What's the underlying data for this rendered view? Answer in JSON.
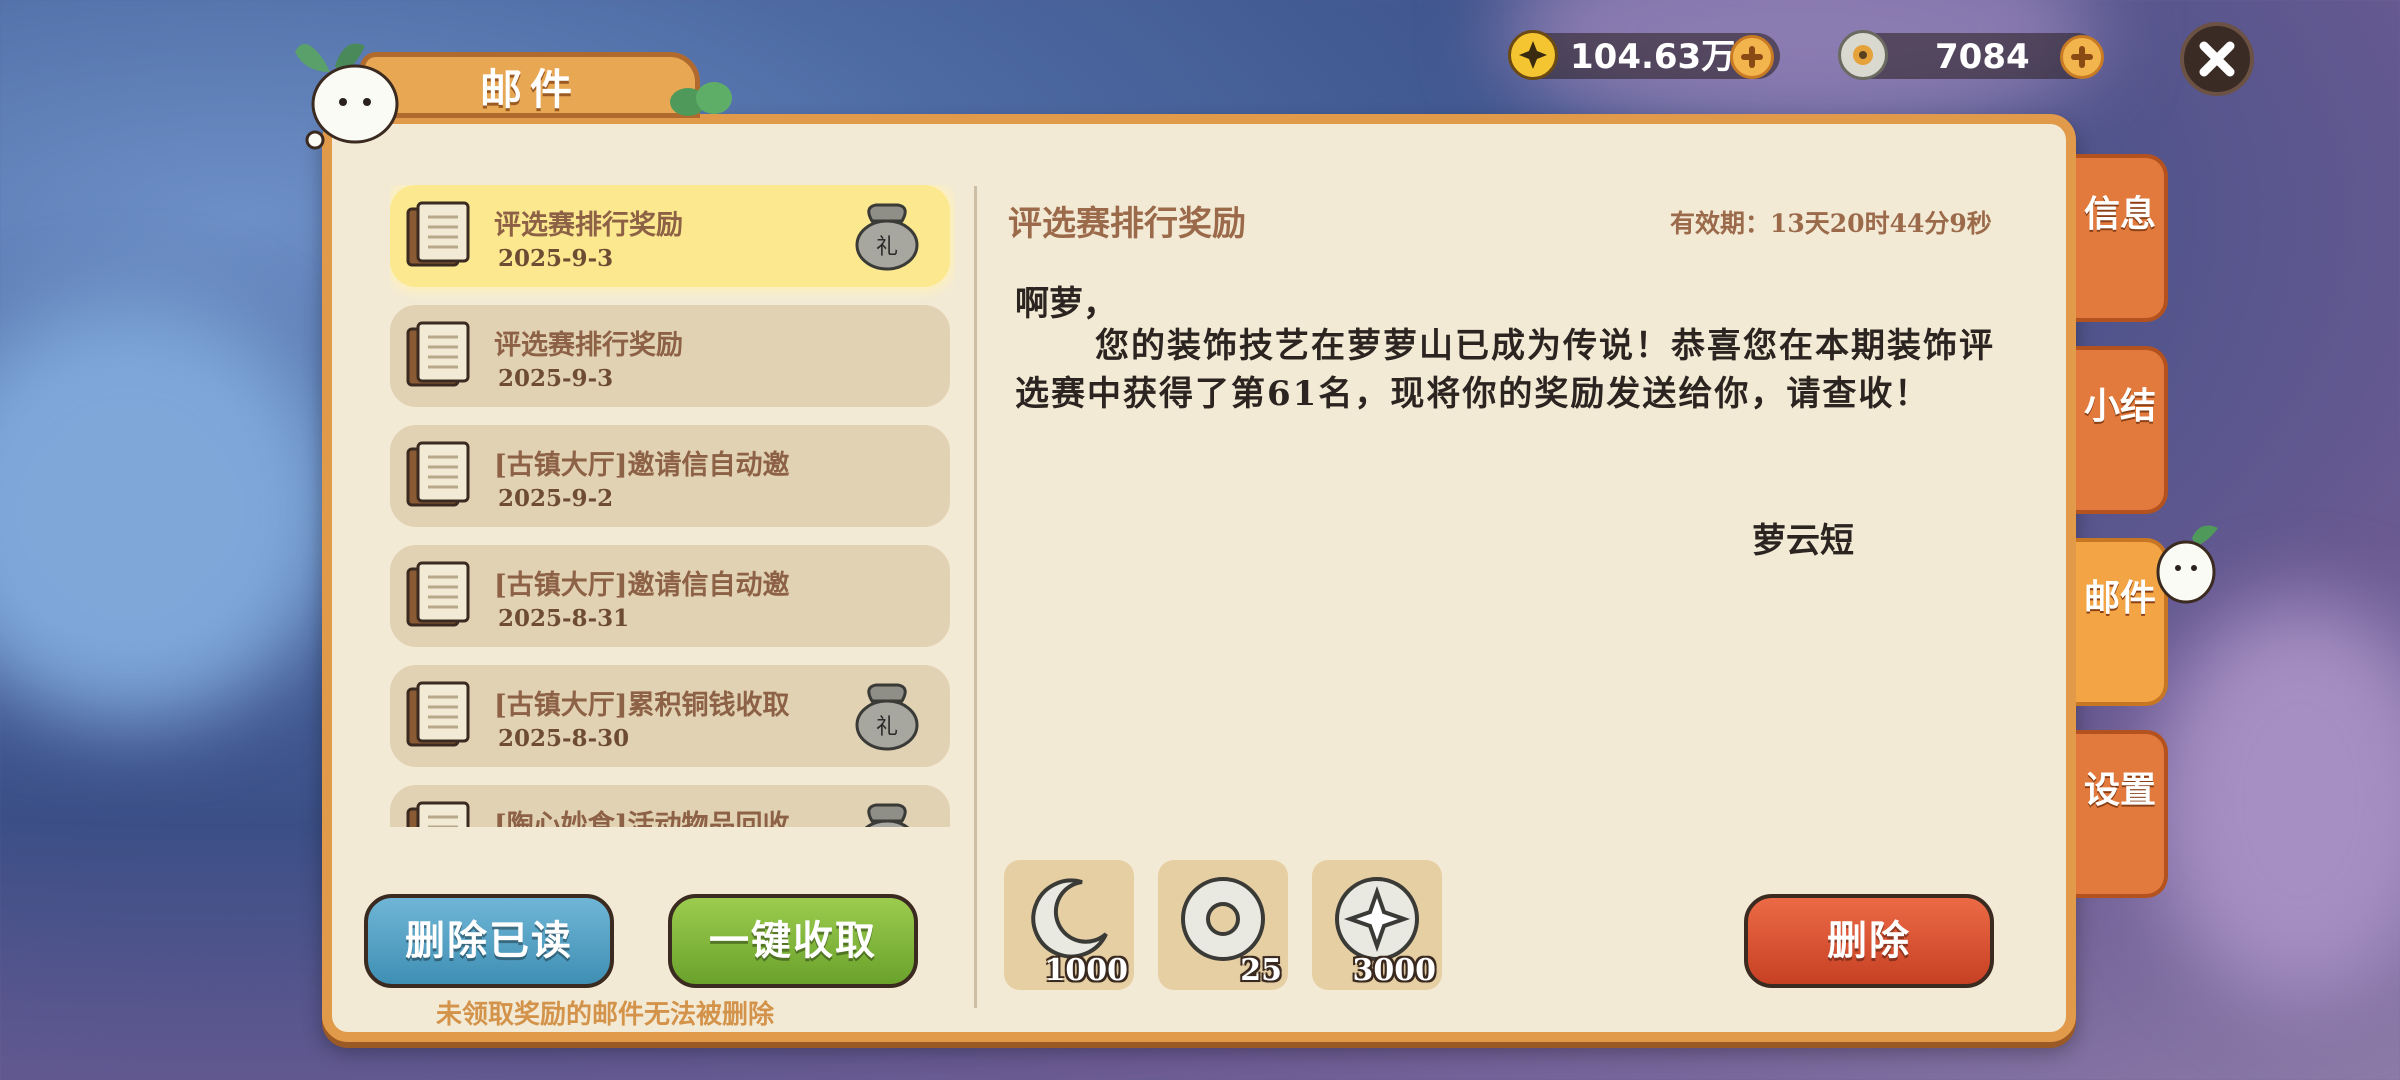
{
  "resources": {
    "currency_one": {
      "icon": "star-coin-icon",
      "value": "104.63万"
    },
    "currency_two": {
      "icon": "copper-coin-icon",
      "value": "7084"
    }
  },
  "window": {
    "title": "邮件"
  },
  "mail_list": [
    {
      "title": "评选赛排行奖励",
      "date": "2025-9-3",
      "has_gift": true,
      "selected": true
    },
    {
      "title": "评选赛排行奖励",
      "date": "2025-9-3",
      "has_gift": false,
      "selected": false
    },
    {
      "title": "[古镇大厅]邀请信自动邀",
      "date": "2025-9-2",
      "has_gift": false,
      "selected": false
    },
    {
      "title": "[古镇大厅]邀请信自动邀",
      "date": "2025-8-31",
      "has_gift": false,
      "selected": false
    },
    {
      "title": "[古镇大厅]累积铜钱收取",
      "date": "2025-8-30",
      "has_gift": true,
      "selected": false
    },
    {
      "title": "[陶心妙食]活动物品回收",
      "date": "",
      "has_gift": true,
      "selected": false
    }
  ],
  "detail": {
    "title": "评选赛排行奖励",
    "expire": "有效期：13天20时44分9秒",
    "salutation": "啊萝，",
    "body": "您的装饰技艺在萝萝山已成为传说！恭喜您在本期装饰评选赛中获得了第61名，现将你的奖励发送给你，请查收！",
    "signature": "萝云短",
    "rewards": [
      {
        "icon": "crescent-moon-icon",
        "count": "1000"
      },
      {
        "icon": "copper-coin-icon",
        "count": "25"
      },
      {
        "icon": "star-coin-icon",
        "count": "3000"
      }
    ]
  },
  "buttons": {
    "delete_read": "删除已读",
    "collect_all": "一键收取",
    "delete": "删除"
  },
  "hint": "未领取奖励的邮件无法被删除",
  "side_tabs": [
    {
      "label": "信息",
      "active": false
    },
    {
      "label": "小结",
      "active": false
    },
    {
      "label": "邮件",
      "active": true
    },
    {
      "label": "设置",
      "active": false
    }
  ],
  "colors": {
    "panel": "#f3ead6",
    "accent": "#e09a4a",
    "selected": "#fbe88f"
  }
}
